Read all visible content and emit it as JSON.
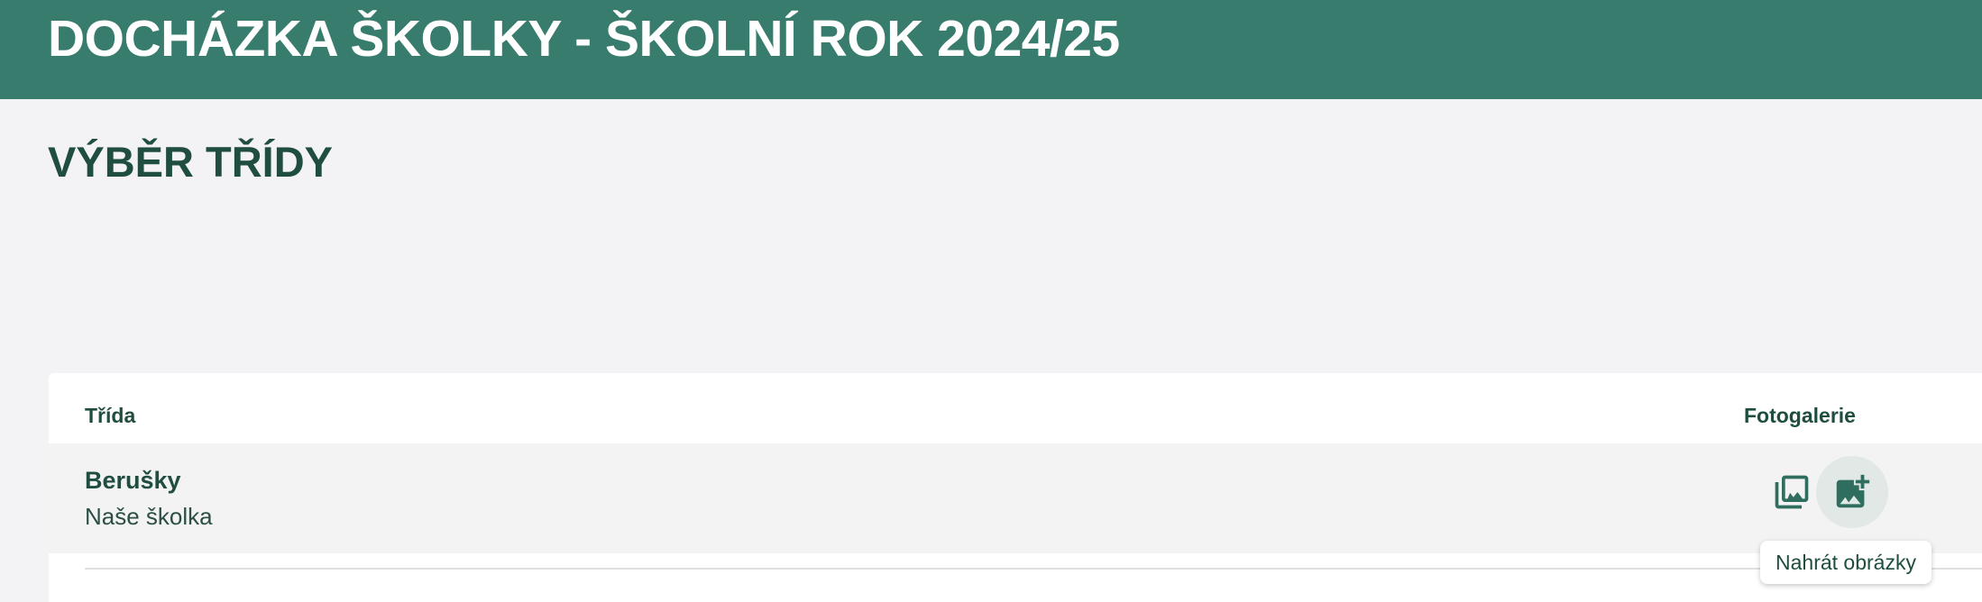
{
  "header": {
    "title": "DOCHÁZKA ŠKOLKY - ŠKOLNÍ ROK 2024/25"
  },
  "page": {
    "heading": "VÝBĚR TŘÍDY"
  },
  "table": {
    "columns": {
      "class": "Třída",
      "gallery": "Fotogalerie"
    },
    "rows": [
      {
        "name": "Berušky",
        "school": "Naše školka",
        "actions": [
          {
            "icon": "photo-library-icon"
          },
          {
            "icon": "add-photo-icon"
          }
        ]
      }
    ]
  },
  "tooltip": {
    "text": "Nahrát obrázky"
  },
  "colors": {
    "header_bg": "#377c6d",
    "primary_text": "#1f4d40",
    "page_bg": "#f3f3f5",
    "row_bg": "#f3f3f4",
    "hover_circle": "#e1e8e6"
  }
}
